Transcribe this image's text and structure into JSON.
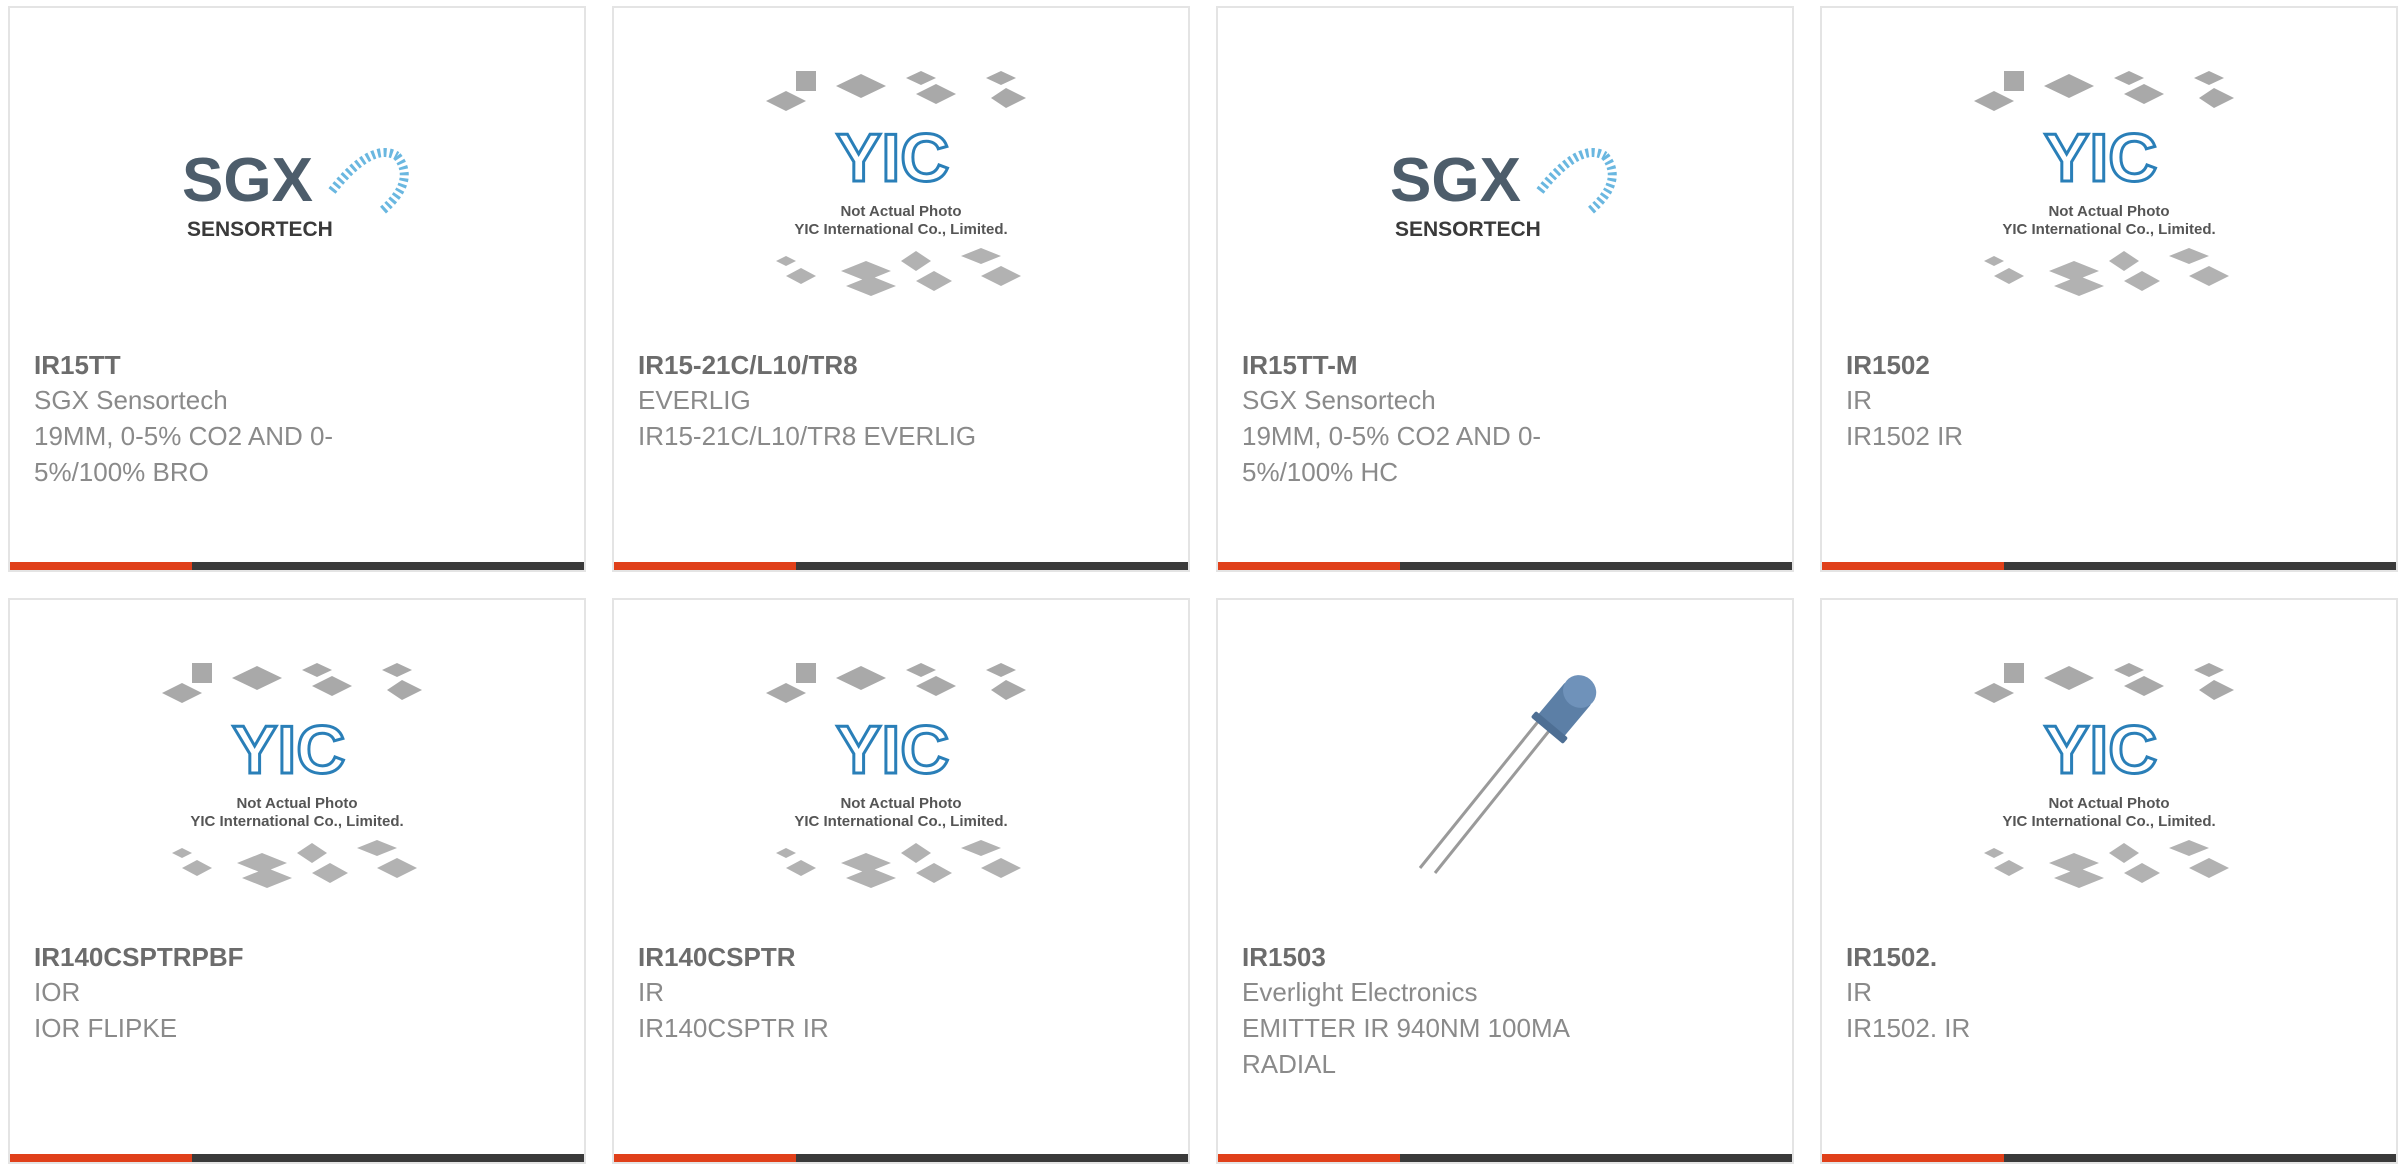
{
  "colors": {
    "accent": "#e0401a",
    "bar": "#3a3a3a",
    "border": "#e4e4e4"
  },
  "logos": {
    "sgx_brand": "SGX",
    "sgx_sub": "SENSORTECH",
    "yic_brand": "YIC",
    "yic_line1": "Not Actual Photo",
    "yic_line2": "YIC International Co., Limited."
  },
  "products": [
    {
      "part": "IR15TT",
      "manufacturer": "SGX Sensortech",
      "description": "19MM, 0-5% CO2 AND 0-5%/100% BRO",
      "image": "sgx-logo"
    },
    {
      "part": "IR15-21C/L10/TR8",
      "manufacturer": "EVERLIG",
      "description": "IR15-21C/L10/TR8 EVERLIG",
      "image": "yic-placeholder"
    },
    {
      "part": "IR15TT-M",
      "manufacturer": "SGX Sensortech",
      "description": "19MM, 0-5% CO2 AND 0-5%/100% HC",
      "image": "sgx-logo"
    },
    {
      "part": "IR1502",
      "manufacturer": "IR",
      "description": "IR1502 IR",
      "image": "yic-placeholder"
    },
    {
      "part": "IR140CSPTRPBF",
      "manufacturer": "IOR",
      "description": "IOR FLIPKE",
      "image": "yic-placeholder"
    },
    {
      "part": "IR140CSPTR",
      "manufacturer": "IR",
      "description": "IR140CSPTR IR",
      "image": "yic-placeholder"
    },
    {
      "part": "IR1503",
      "manufacturer": "Everlight Electronics",
      "description": "EMITTER IR 940NM 100MA RADIAL",
      "image": "led-photo"
    },
    {
      "part": "IR1502.",
      "manufacturer": "IR",
      "description": "IR1502. IR",
      "image": "yic-placeholder"
    }
  ]
}
